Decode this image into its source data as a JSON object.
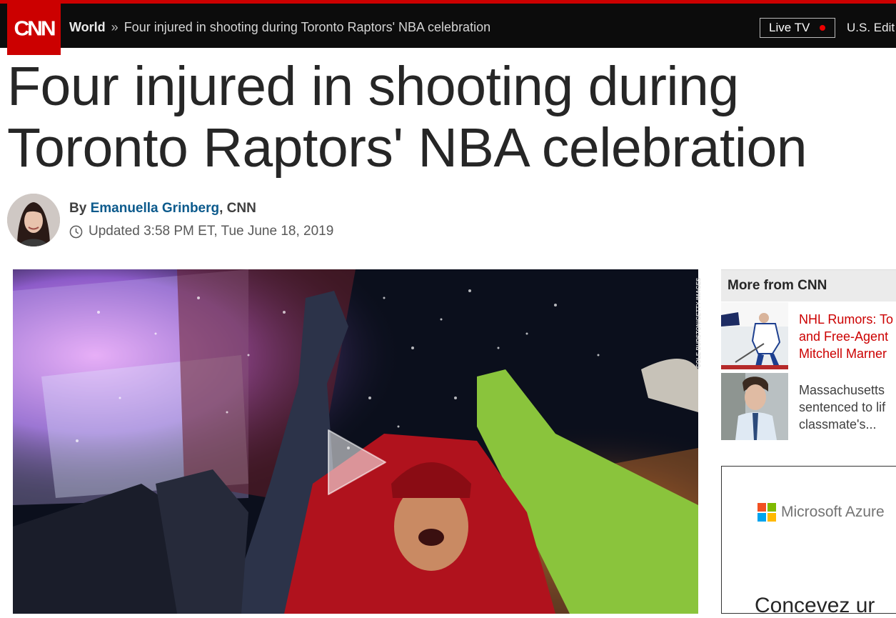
{
  "header": {
    "logo_text": "CNN",
    "section": "World",
    "separator": "»",
    "crumb_title": "Four injured in shooting during Toronto Raptors' NBA celebration",
    "live_tv": "Live TV",
    "edition": "U.S. Edit"
  },
  "article": {
    "headline_line1": "Four injured in shooting during",
    "headline_line2": "Toronto Raptors' NBA celebration",
    "by": "By",
    "author": "Emanuella Grinberg",
    "outlet": ", CNN",
    "updated": "Updated 3:58 PM ET, Tue June 18, 2019",
    "photo_credit": "COLE BURSTON/GETTY IMAGES"
  },
  "rail": {
    "title": "More from CNN",
    "items": [
      {
        "line1": "NHL Rumors: To",
        "line2": "and Free-Agent",
        "line3": "Mitchell Marner",
        "color": "#cc0000"
      },
      {
        "line1": "Massachusetts",
        "line2": "sentenced to lif",
        "line3": "classmate's...",
        "color": "#404040"
      }
    ]
  },
  "ad": {
    "brand": "Microsoft Azure",
    "cta": "Concevez ur"
  },
  "colors": {
    "brand_red": "#cc0000",
    "link_blue": "#0c5a8c",
    "nav_bg": "#0c0c0c"
  }
}
